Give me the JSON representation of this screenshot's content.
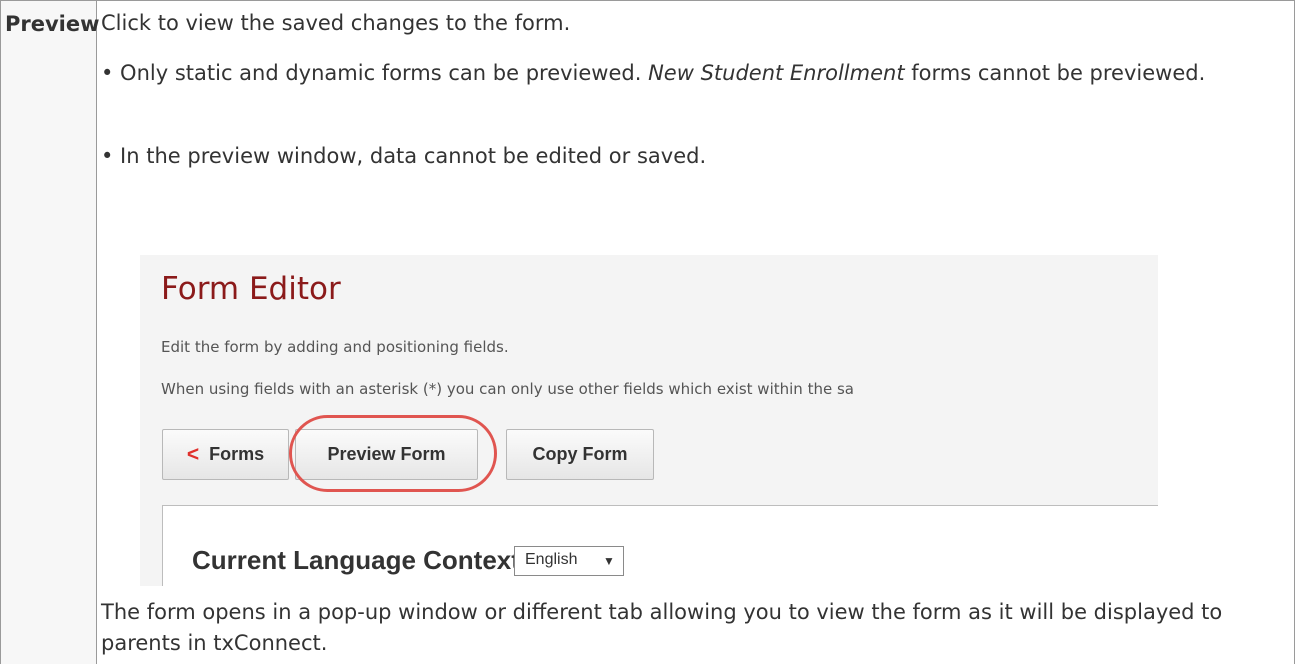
{
  "term": "Preview",
  "description": {
    "intro": "Click to view the saved changes to the form.",
    "bullet1_pre": "• Only static and dynamic forms can be previewed. ",
    "bullet1_italic": "New Student Enrollment",
    "bullet1_post": " forms cannot be previewed.",
    "bullet2": "• In the preview window, data cannot be edited or saved.",
    "outro": "The form opens in a pop-up window or different tab allowing you to view the form as it will be displayed to parents in txConnect."
  },
  "screenshot": {
    "title": "Form Editor",
    "desc1": "Edit the form by adding and positioning fields.",
    "desc2": "When using fields with an asterisk (*) you can only use other fields which exist within the sa",
    "buttons": {
      "forms_arrow": "<",
      "forms": "Forms",
      "preview": "Preview Form",
      "copy": "Copy Form"
    },
    "context_label": "Current Language Context:",
    "language_value": "English",
    "highlight_color": "#e05550",
    "title_color": "#8b1a1a"
  }
}
